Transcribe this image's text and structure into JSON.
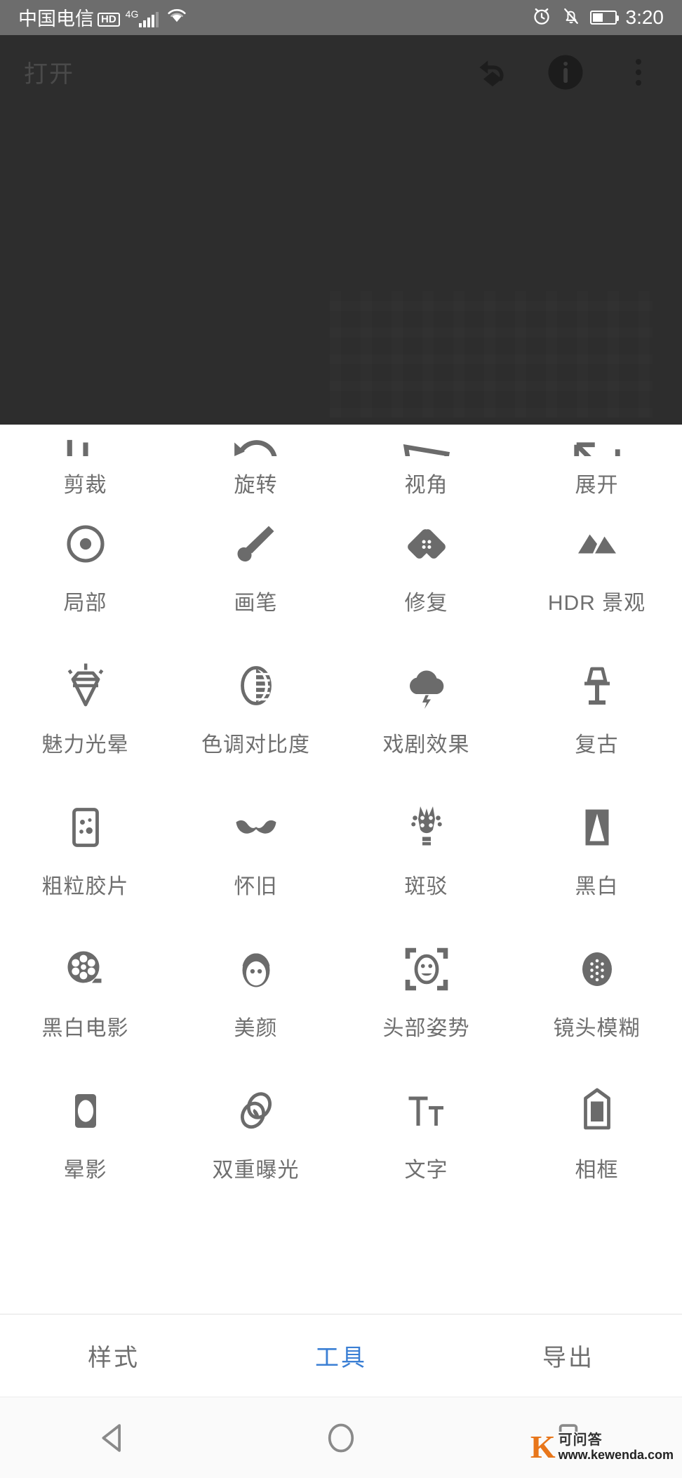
{
  "status_bar": {
    "carrier": "中国电信",
    "hd_badge": "HD",
    "network": "4G",
    "time": "3:20",
    "icons": [
      "signal-bars-icon",
      "wifi-icon",
      "alarm-clock-icon",
      "bell-muted-icon",
      "battery-icon"
    ],
    "background_color": "#6d6d6d"
  },
  "app_bar": {
    "title": "打开",
    "icons": [
      "undo-stack-icon",
      "info-icon",
      "overflow-menu-icon"
    ],
    "background_color": "#2d2d2d"
  },
  "canvas": {
    "background_color": "#2d2d2d"
  },
  "tools": {
    "accent_color": "#3b7fd4",
    "label_color": "#6f6f6f",
    "icon_color": "#6b6b6b",
    "rows": [
      {
        "clipped": true,
        "items": [
          {
            "label": "剪裁",
            "icon": "crop-icon"
          },
          {
            "label": "旋转",
            "icon": "rotate-icon"
          },
          {
            "label": "视角",
            "icon": "perspective-icon"
          },
          {
            "label": "展开",
            "icon": "expand-icon"
          }
        ]
      },
      {
        "clipped": false,
        "items": [
          {
            "label": "局部",
            "icon": "selective-target-icon"
          },
          {
            "label": "画笔",
            "icon": "brush-icon"
          },
          {
            "label": "修复",
            "icon": "healing-patch-icon"
          },
          {
            "label": "HDR 景观",
            "icon": "hdr-mountain-icon"
          }
        ]
      },
      {
        "clipped": false,
        "items": [
          {
            "label": "魅力光晕",
            "icon": "glamour-glow-diamond-icon"
          },
          {
            "label": "色调对比度",
            "icon": "tonal-contrast-icon"
          },
          {
            "label": "戏剧效果",
            "icon": "drama-cloud-icon"
          },
          {
            "label": "复古",
            "icon": "vintage-lamp-icon"
          }
        ]
      },
      {
        "clipped": false,
        "items": [
          {
            "label": "粗粒胶片",
            "icon": "grainy-film-icon"
          },
          {
            "label": "怀旧",
            "icon": "retrolux-mustache-icon"
          },
          {
            "label": "斑驳",
            "icon": "grunge-icon"
          },
          {
            "label": "黑白",
            "icon": "black-white-icon"
          }
        ]
      },
      {
        "clipped": false,
        "items": [
          {
            "label": "黑白电影",
            "icon": "noir-film-reel-icon"
          },
          {
            "label": "美颜",
            "icon": "face-enhance-icon"
          },
          {
            "label": "头部姿势",
            "icon": "head-pose-icon"
          },
          {
            "label": "镜头模糊",
            "icon": "lens-blur-icon"
          }
        ]
      },
      {
        "clipped": false,
        "items": [
          {
            "label": "晕影",
            "icon": "vignette-icon"
          },
          {
            "label": "双重曝光",
            "icon": "double-exposure-icon"
          },
          {
            "label": "文字",
            "icon": "text-icon"
          },
          {
            "label": "相框",
            "icon": "frame-icon"
          }
        ]
      }
    ]
  },
  "tab_bar": {
    "tabs": [
      {
        "label": "样式",
        "active": false
      },
      {
        "label": "工具",
        "active": true
      },
      {
        "label": "导出",
        "active": false
      }
    ]
  },
  "nav_bar": {
    "buttons": [
      {
        "icon": "back-triangle-icon"
      },
      {
        "icon": "home-circle-icon"
      },
      {
        "icon": "recents-square-icon"
      }
    ]
  },
  "watermark": {
    "logo": "K",
    "name": "可问答",
    "url": "www.kewenda.com",
    "color": "#e8761a"
  }
}
